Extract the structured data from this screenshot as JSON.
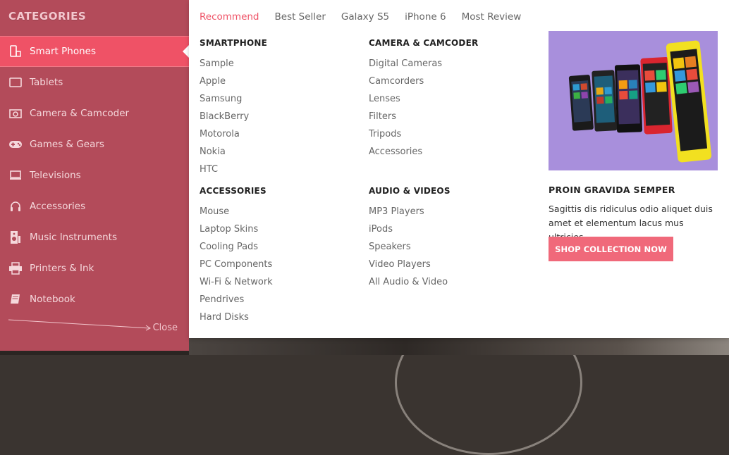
{
  "sidebar": {
    "title": "CATEGORIES",
    "items": [
      {
        "label": "Smart Phones",
        "icon": "smartphone-icon"
      },
      {
        "label": "Tablets",
        "icon": "tablet-icon"
      },
      {
        "label": "Camera & Camcoder",
        "icon": "camera-icon"
      },
      {
        "label": "Games & Gears",
        "icon": "gamepad-icon"
      },
      {
        "label": "Televisions",
        "icon": "monitor-icon"
      },
      {
        "label": "Accessories",
        "icon": "headphones-icon"
      },
      {
        "label": "Music Instruments",
        "icon": "speaker-icon"
      },
      {
        "label": "Printers & Ink",
        "icon": "printer-icon"
      },
      {
        "label": "Notebook",
        "icon": "book-icon"
      }
    ],
    "close_label": "Close"
  },
  "tabs": [
    "Recommend",
    "Best Seller",
    "Galaxy S5",
    "iPhone 6",
    "Most Review"
  ],
  "columns": {
    "smartphone": {
      "title": "SMARTPHONE",
      "items": [
        "Sample",
        "Apple",
        "Samsung",
        "BlackBerry",
        "Motorola",
        "Nokia",
        "HTC"
      ]
    },
    "camera": {
      "title": "CAMERA & CAMCODER",
      "items": [
        "Digital Cameras",
        "Camcorders",
        "Lenses",
        "Filters",
        "Tripods",
        "Accessories"
      ]
    },
    "accessories": {
      "title": "ACCESSORIES",
      "items": [
        "Mouse",
        "Laptop Skins",
        "Cooling Pads",
        "PC Components",
        "Wi-Fi & Network",
        "Pendrives",
        "Hard Disks"
      ]
    },
    "audio": {
      "title": "AUDIO & VIDEOS",
      "items": [
        "MP3 Players",
        "iPods",
        "Speakers",
        "Video Players",
        "All Audio & Video"
      ]
    }
  },
  "promo": {
    "title": "PROIN GRAVIDA SEMPER",
    "text": "Sagittis dis ridiculus odio aliquet duis amet et elementum lacus mus ultricies",
    "button": "SHOP COLLECTION NOW"
  },
  "colors": {
    "accent": "#ef5266",
    "sidebar": "#b34b5a",
    "promo_bg": "#a88fdc"
  }
}
